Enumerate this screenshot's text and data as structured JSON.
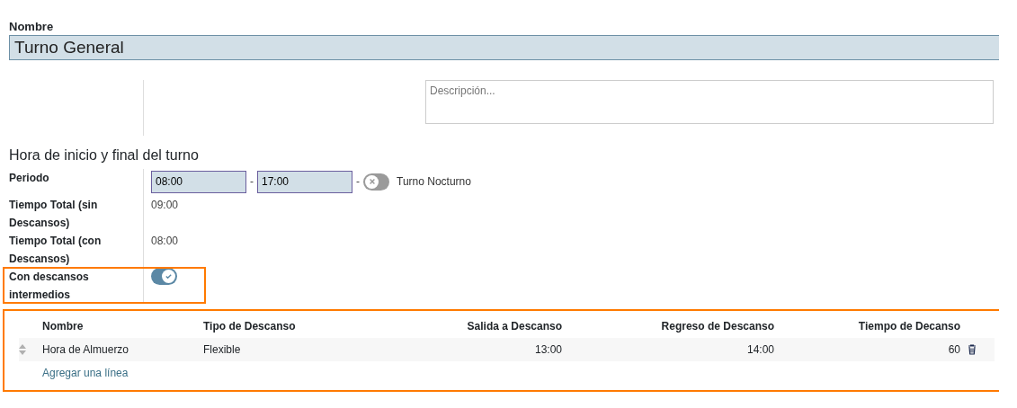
{
  "name_field": {
    "label": "Nombre",
    "value": "Turno General"
  },
  "description": {
    "placeholder": "Descripción..."
  },
  "section_title": "Hora de inicio y final del turno",
  "period": {
    "label": "Periodo",
    "start": "08:00",
    "separator_1": "-",
    "end": "17:00",
    "separator_2": "-",
    "night_shift": {
      "label": "Turno Nocturno",
      "on": false
    }
  },
  "totals": [
    {
      "label": "Tiempo Total (sin Descansos)",
      "value": "09:00"
    },
    {
      "label": "Tiempo Total (con Descansos)",
      "value": "08:00"
    }
  ],
  "breaks_toggle": {
    "label": "Con descansos intermedios",
    "on": true
  },
  "table": {
    "columns": [
      {
        "label": "Nombre",
        "kind": "text"
      },
      {
        "label": "Tipo de Descanso",
        "kind": "text"
      },
      {
        "label": "Salida a Descanso",
        "kind": "time"
      },
      {
        "label": "Regreso de Descanso",
        "kind": "time"
      },
      {
        "label": "Tiempo de Decanso",
        "kind": "number"
      }
    ],
    "rows": [
      {
        "cells": [
          "Hora de Almuerzo",
          "Flexible",
          "13:00",
          "14:00",
          "60"
        ]
      }
    ],
    "add_line": "Agregar una línea"
  }
}
